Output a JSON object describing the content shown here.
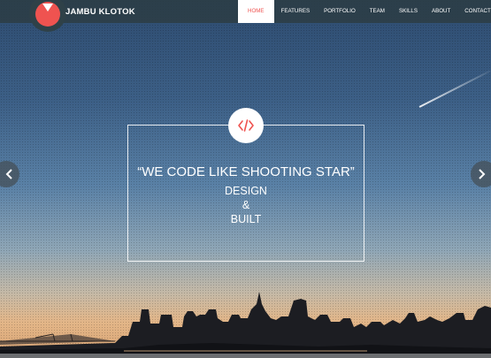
{
  "header": {
    "brand": "JAMBU KLOTOK",
    "nav": [
      {
        "label": "HOME",
        "active": true
      },
      {
        "label": "FEATURES",
        "active": false
      },
      {
        "label": "PORTFOLIO",
        "active": false
      },
      {
        "label": "TEAM",
        "active": false
      },
      {
        "label": "SKILLS",
        "active": false
      },
      {
        "label": "ABOUT",
        "active": false
      },
      {
        "label": "CONTACT",
        "active": false
      }
    ]
  },
  "hero": {
    "icon": "code-icon",
    "headline": "“WE CODE LIKE SHOOTING STAR”",
    "line1": "DESIGN",
    "line2": "&",
    "line3": "BUILT"
  },
  "slider": {
    "prev_icon": "chevron-left-icon",
    "next_icon": "chevron-right-icon"
  },
  "colors": {
    "accent": "#ef5350",
    "header_bg": "#2c3e46",
    "text": "#ffffff"
  }
}
